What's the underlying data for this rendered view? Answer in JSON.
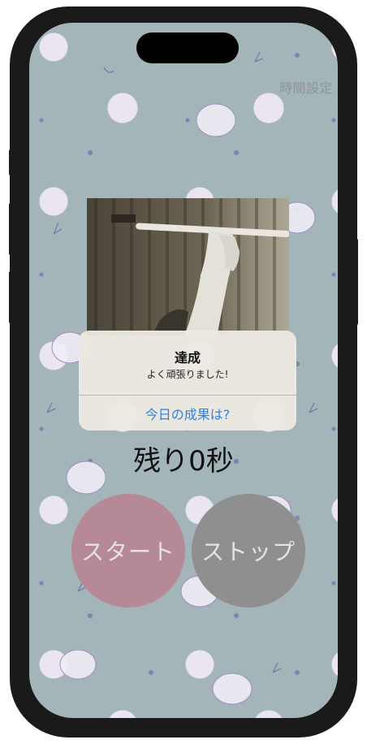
{
  "header": {
    "time_setting_label": "時間設定"
  },
  "alert": {
    "title": "達成",
    "message": "よく頑張りました!",
    "action_label": "今日の成果は?"
  },
  "timer": {
    "remaining_text": "残り0秒"
  },
  "controls": {
    "start_label": "スタート",
    "stop_label": "ストップ"
  },
  "colors": {
    "background": "#a3b5b8",
    "start_button": "#b58a96",
    "stop_button": "#8f8f8f",
    "alert_action": "#2f7fe0"
  }
}
